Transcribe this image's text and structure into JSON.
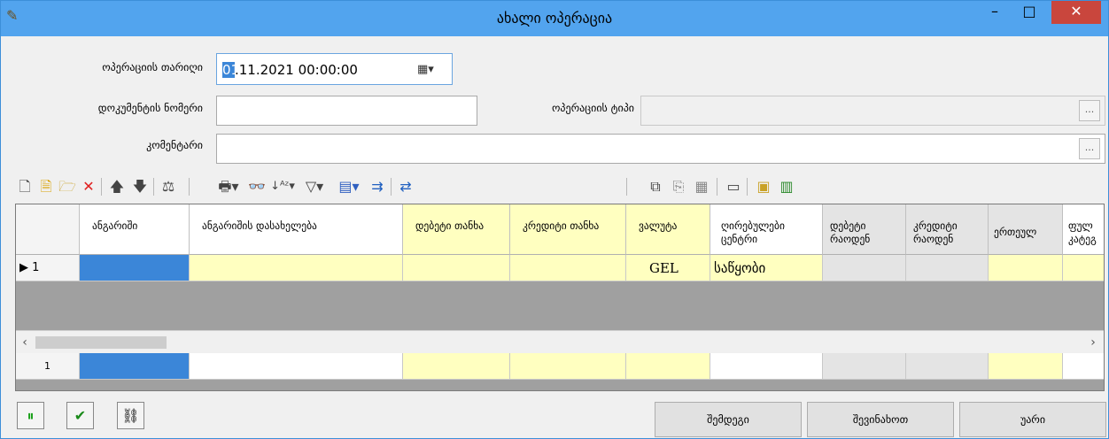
{
  "window": {
    "title": "ახალი ოპერაცია",
    "minimize": "–",
    "maximize": "□",
    "close": "✕"
  },
  "form": {
    "operation_date_label": "ოპერაციის თარიღი",
    "operation_date_selected": "01",
    "operation_date_rest": ".11.2021 00:00:00",
    "document_number_label": "დოკუმენტის ნომერი",
    "document_number_value": "",
    "operation_type_label": "ოპერაციის ტიპი",
    "operation_type_value": "",
    "comment_label": "კომენტარი",
    "comment_value": "",
    "ellipsis": "..."
  },
  "grid": {
    "columns": [
      "ანგარიში",
      "ანგარიშის დასახელება",
      "დებეტი თანხა",
      "კრედიტი თანხა",
      "ვალუტა",
      "ღირებულები ცენტრი",
      "დებეტი რაოდენ",
      "კრედიტი რაოდენ",
      "ერთეულ",
      "ფულ კატეგ"
    ],
    "rows": [
      {
        "indicator": "▶ 1",
        "currency": "GEL",
        "cost_center": "საწყობი"
      }
    ],
    "total_row_indicator": "1"
  },
  "colors": {
    "titlebar": "#52a4ee",
    "close_button": "#c9463d",
    "selected_cell": "#3b86d8",
    "yellow_cell": "#ffffc0",
    "gray_cell": "#e4e4e4",
    "grid_background": "#a0a0a0"
  },
  "footer": {
    "next_label": "შემდეგი",
    "save_label": "შევინახოთ",
    "cancel_label": "უარი"
  }
}
